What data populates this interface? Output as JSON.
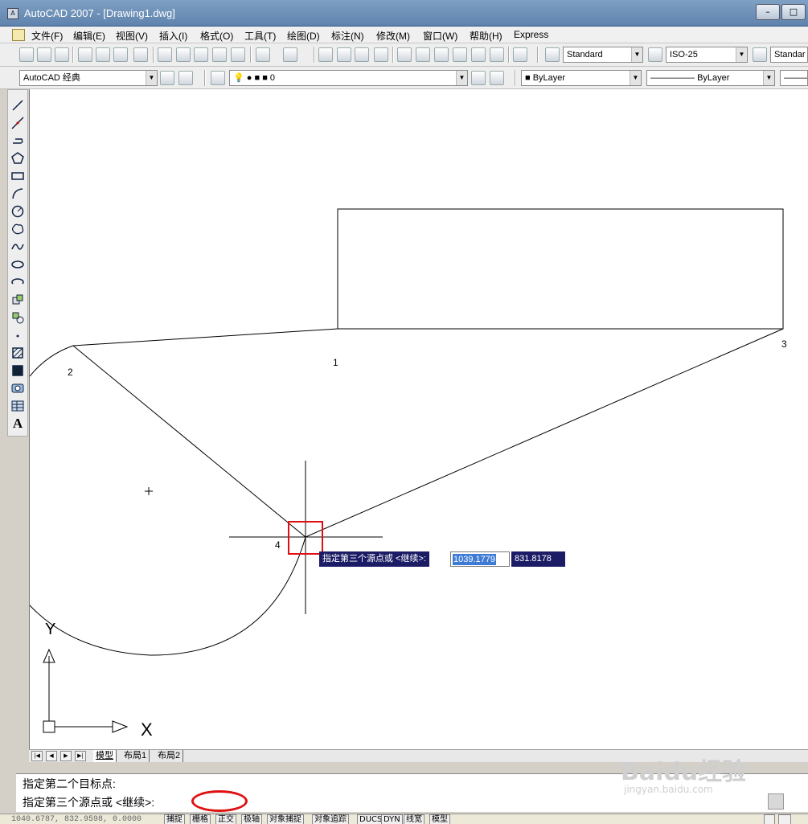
{
  "window": {
    "title": "AutoCAD 2007 - [Drawing1.dwg]",
    "minimize": "–",
    "maximize": "□"
  },
  "menu": [
    "文件(F)",
    "编辑(E)",
    "视图(V)",
    "插入(I)",
    "格式(O)",
    "工具(T)",
    "绘图(D)",
    "标注(N)",
    "修改(M)",
    "窗口(W)",
    "帮助(H)",
    "Express"
  ],
  "toolbar": {
    "text_style": "Standard",
    "dim_style": "ISO-25",
    "table_style": "Standar",
    "workspace": "AutoCAD 经典",
    "layer": "0",
    "color": "ByLayer",
    "linetype": "ByLayer"
  },
  "drawing": {
    "labels": [
      "1",
      "2",
      "3",
      "4"
    ],
    "axis_x": "X",
    "axis_y": "Y"
  },
  "dynamic_input": {
    "prompt": "指定第三个源点或 <继续>:",
    "x_value": "1039.1779",
    "y_value": "831.8178"
  },
  "layout_tabs": [
    "模型",
    "布局1",
    "布局2"
  ],
  "command_line": {
    "line1": "指定第二个目标点:",
    "line2": "指定第三个源点或 <继续>:"
  },
  "status_bar": {
    "coordinates": "1040.6787, 832.9598, 0.0000",
    "buttons": [
      "捕捉",
      "栅格",
      "正交",
      "极轴",
      "对象捕捉",
      "对象追踪",
      "DUCS",
      "DYN",
      "线宽",
      "模型"
    ]
  },
  "watermark": {
    "text": "Baidu经验",
    "url": "jingyan.baidu.com"
  },
  "colors": {
    "highlight": "#e01010",
    "dyn_bg": "#1c1c66",
    "selection": "#3d7bd6"
  }
}
